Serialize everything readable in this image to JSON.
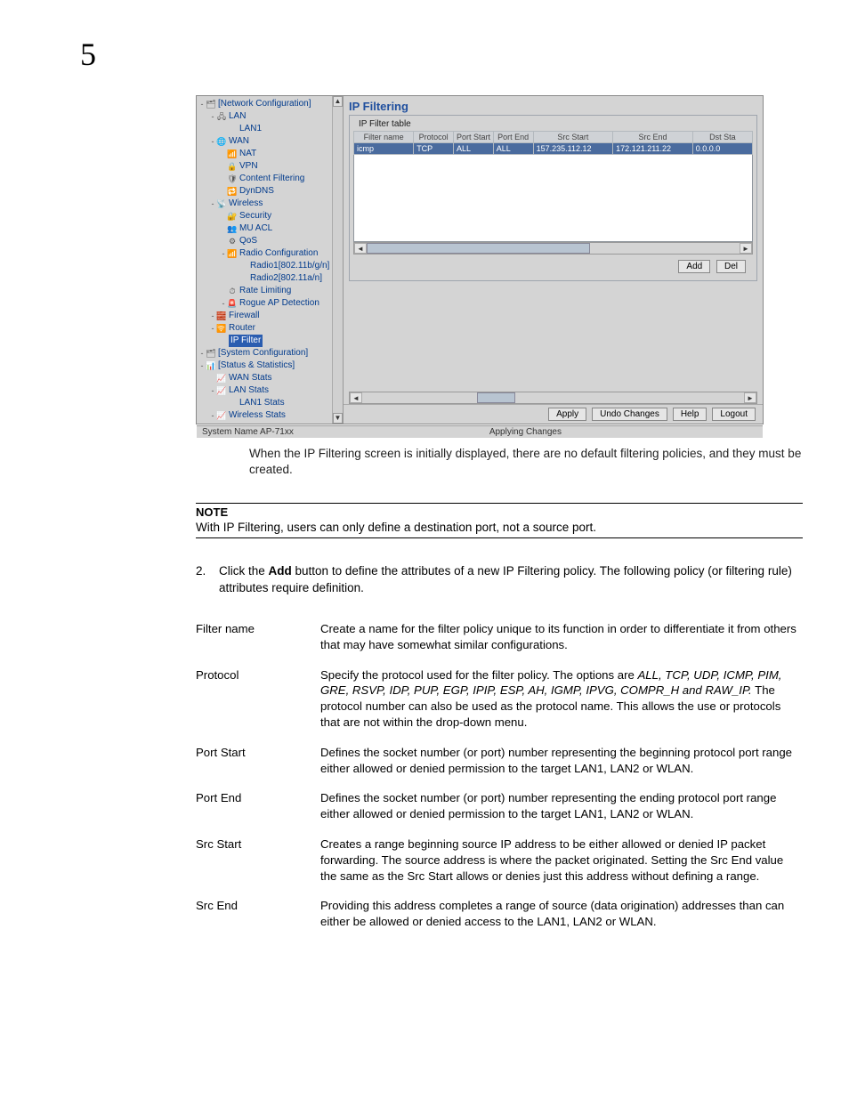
{
  "pageNumber": "5",
  "screenshot": {
    "tree": [
      {
        "lvl": 0,
        "tw": "-",
        "ic": "🗂",
        "label": "[Network Configuration]"
      },
      {
        "lvl": 1,
        "tw": "-",
        "ic": "🖧",
        "label": "LAN"
      },
      {
        "lvl": 2,
        "tw": "",
        "ic": "",
        "label": "LAN1"
      },
      {
        "lvl": 1,
        "tw": "-",
        "ic": "🌐",
        "label": "WAN"
      },
      {
        "lvl": 2,
        "tw": "",
        "ic": "📶",
        "label": "NAT"
      },
      {
        "lvl": 2,
        "tw": "",
        "ic": "🔒",
        "label": "VPN"
      },
      {
        "lvl": 2,
        "tw": "",
        "ic": "🛡",
        "label": "Content Filtering"
      },
      {
        "lvl": 2,
        "tw": "",
        "ic": "🔁",
        "label": "DynDNS"
      },
      {
        "lvl": 1,
        "tw": "-",
        "ic": "📡",
        "label": "Wireless"
      },
      {
        "lvl": 2,
        "tw": "",
        "ic": "🔐",
        "label": "Security"
      },
      {
        "lvl": 2,
        "tw": "",
        "ic": "👥",
        "label": "MU ACL"
      },
      {
        "lvl": 2,
        "tw": "",
        "ic": "⚙",
        "label": "QoS"
      },
      {
        "lvl": 2,
        "tw": "-",
        "ic": "📶",
        "label": "Radio Configuration"
      },
      {
        "lvl": 3,
        "tw": "",
        "ic": "",
        "label": "Radio1[802.11b/g/n]"
      },
      {
        "lvl": 3,
        "tw": "",
        "ic": "",
        "label": "Radio2[802.11a/n]"
      },
      {
        "lvl": 2,
        "tw": "",
        "ic": "⏱",
        "label": "Rate Limiting"
      },
      {
        "lvl": 2,
        "tw": "-",
        "ic": "🚨",
        "label": "Rogue AP Detection"
      },
      {
        "lvl": 1,
        "tw": "-",
        "ic": "🧱",
        "label": "Firewall"
      },
      {
        "lvl": 1,
        "tw": "-",
        "ic": "🛜",
        "label": "Router"
      },
      {
        "lvl": 1,
        "tw": "",
        "ic": "",
        "label": "IP Filter",
        "selected": true
      },
      {
        "lvl": 0,
        "tw": "-",
        "ic": "🗂",
        "label": "[System Configuration]"
      },
      {
        "lvl": 0,
        "tw": "-",
        "ic": "📊",
        "label": "[Status & Statistics]"
      },
      {
        "lvl": 1,
        "tw": "",
        "ic": "📈",
        "label": "WAN Stats"
      },
      {
        "lvl": 1,
        "tw": "-",
        "ic": "📈",
        "label": "LAN Stats"
      },
      {
        "lvl": 2,
        "tw": "",
        "ic": "",
        "label": "LAN1 Stats"
      },
      {
        "lvl": 1,
        "tw": "-",
        "ic": "📈",
        "label": "Wireless Stats"
      }
    ],
    "contentTitle": "IP Filtering",
    "fieldsetLegend": "IP Filter table",
    "columns": [
      "Filter name",
      "Protocol",
      "Port Start",
      "Port End",
      "Src Start",
      "Src End",
      "Dst Sta"
    ],
    "row": [
      "icmp",
      "TCP",
      "ALL",
      "ALL",
      "157.235.112.12",
      "172.121.211.22",
      "0.0.0.0"
    ],
    "btnAdd": "Add",
    "btnDel": "Del",
    "btnApply": "Apply",
    "btnUndo": "Undo Changes",
    "btnHelp": "Help",
    "btnLogout": "Logout",
    "statusLeft": "System Name AP-71xx",
    "statusCenter": "Applying Changes"
  },
  "captionText": "When the IP Filtering screen is initially displayed, there are no default filtering policies, and they must be created.",
  "note": {
    "title": "NOTE",
    "text": "With IP Filtering, users can only define a destination port, not a source port."
  },
  "step": {
    "num": "2.",
    "pre": "Click the ",
    "bold": "Add",
    "post": " button to define the attributes of a new IP Filtering policy. The following policy (or filtering rule) attributes require definition."
  },
  "defs": [
    {
      "term": "Filter name",
      "desc": "Create a name for the filter policy unique to its function in order to differentiate it from others that may have somewhat similar configurations."
    },
    {
      "term": "Protocol",
      "descPre": "Specify the protocol used for the filter policy. The options are ",
      "italic": "ALL, TCP, UDP, ICMP, PIM, GRE, RSVP, IDP, PUP, EGP, IPIP, ESP, AH, IGMP, IPVG, COMPR_H and RAW_IP.",
      "descPost": " The protocol number can also be used as the protocol name. This allows the use or protocols that are not within the drop-down menu."
    },
    {
      "term": "Port Start",
      "desc": "Defines the socket number (or port) number representing the beginning protocol port range either allowed or denied permission to the target LAN1, LAN2 or WLAN."
    },
    {
      "term": "Port End",
      "desc": "Defines the socket number (or port) number representing the ending protocol port range either allowed or denied permission to the target LAN1, LAN2 or WLAN."
    },
    {
      "term": "Src Start",
      "desc": "Creates a range beginning source IP address to be either allowed or denied IP packet forwarding. The source address is where the packet originated. Setting the Src End value the same as the Src Start allows or denies just this address without defining a range."
    },
    {
      "term": "Src End",
      "desc": "Providing this address completes a range of source (data origination) addresses than can either be allowed or denied access to the LAN1, LAN2 or WLAN."
    }
  ]
}
